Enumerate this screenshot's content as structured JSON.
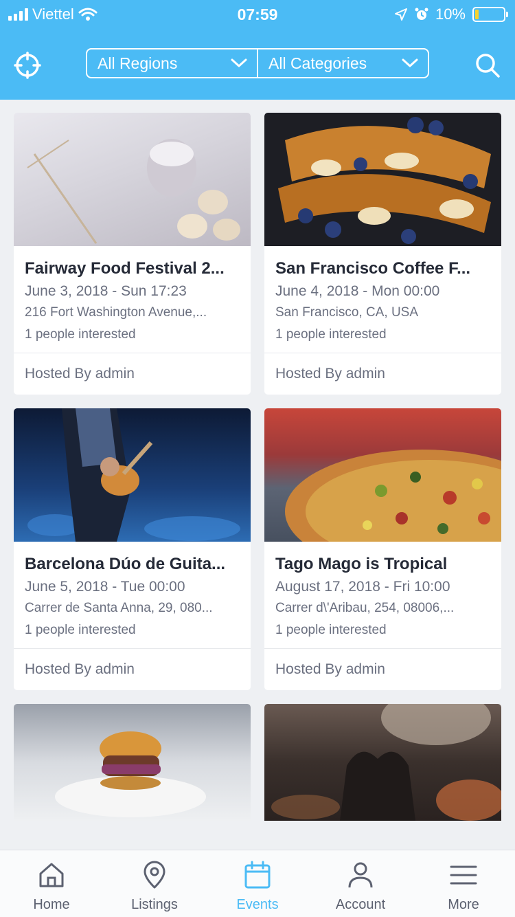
{
  "status_bar": {
    "carrier": "Viettel",
    "time": "07:59",
    "battery": "10%"
  },
  "header": {
    "region_filter": "All Regions",
    "category_filter": "All Categories"
  },
  "events": [
    {
      "title": "Fairway Food Festival 2...",
      "date": "June 3, 2018 - Sun 17:23",
      "address": "216 Fort Washington Avenue,...",
      "interested": "1 people interested",
      "host": "Hosted By admin"
    },
    {
      "title": "San Francisco Coffee F...",
      "date": "June 4, 2018 - Mon 00:00",
      "address": "San Francisco, CA, USA",
      "interested": "1 people interested",
      "host": "Hosted By admin"
    },
    {
      "title": "Barcelona Dúo de Guita...",
      "date": "June 5, 2018 - Tue 00:00",
      "address": "Carrer de Santa Anna, 29, 080...",
      "interested": "1 people interested",
      "host": "Hosted By admin"
    },
    {
      "title": "Tago Mago is Tropical",
      "date": "August 17, 2018 - Fri 10:00",
      "address": "Carrer d\\'Aribau, 254, 08006,...",
      "interested": "1 people interested",
      "host": "Hosted By admin"
    }
  ],
  "tabs": [
    {
      "label": "Home",
      "icon": "home-icon"
    },
    {
      "label": "Listings",
      "icon": "map-pin-icon"
    },
    {
      "label": "Events",
      "icon": "calendar-icon",
      "active": true
    },
    {
      "label": "Account",
      "icon": "user-icon"
    },
    {
      "label": "More",
      "icon": "menu-icon"
    }
  ],
  "colors": {
    "accent": "#4bbbf5",
    "background": "#eef0f3",
    "text": "#252a37",
    "muted": "#6b7080"
  }
}
